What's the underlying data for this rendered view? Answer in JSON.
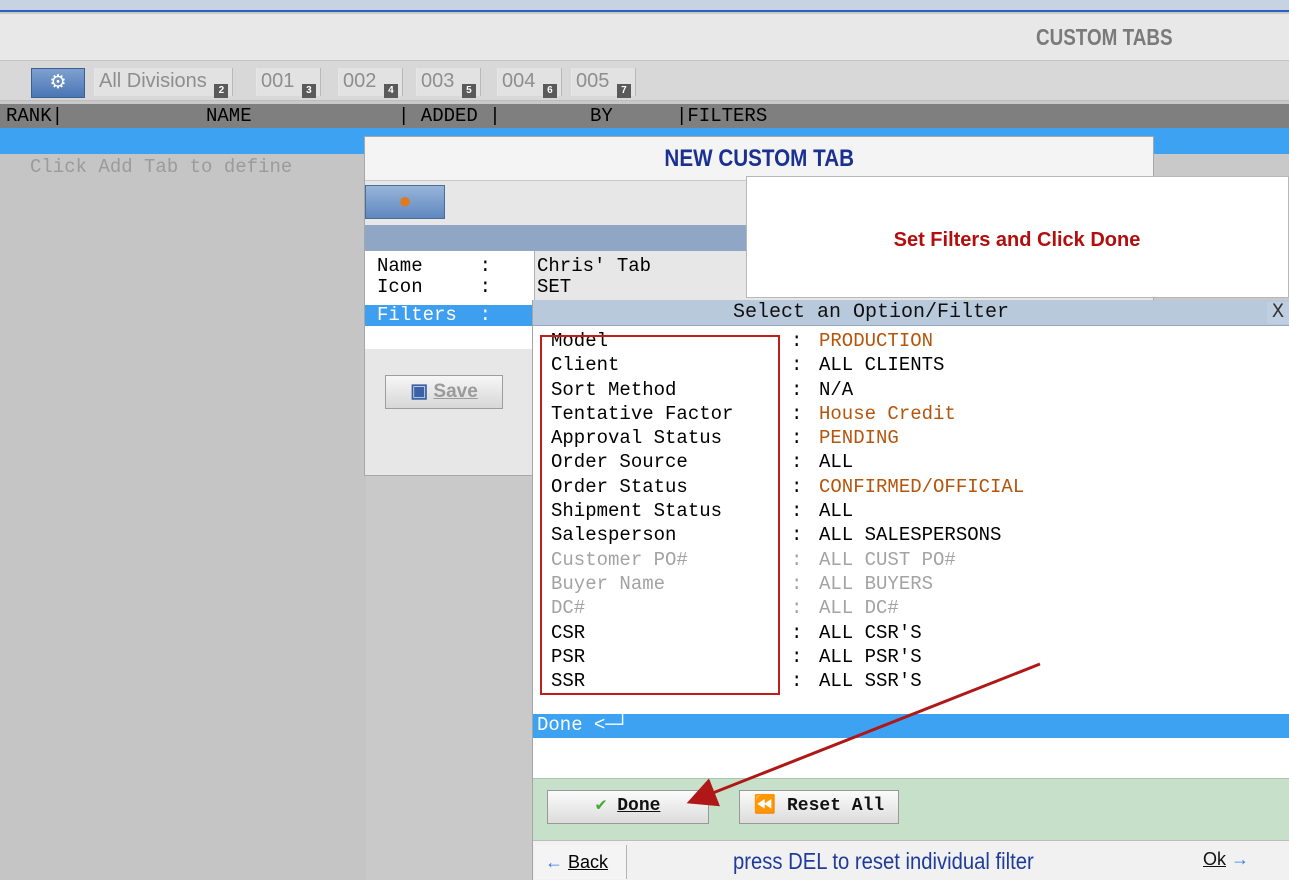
{
  "app": {
    "title": "CUSTOM TABS"
  },
  "tabs": {
    "gear_icon": "gear-icon",
    "items": [
      {
        "label": "All Divisions",
        "badge": "2"
      },
      {
        "label": "001",
        "badge": "3"
      },
      {
        "label": "002",
        "badge": "4"
      },
      {
        "label": "003",
        "badge": "5"
      },
      {
        "label": "004",
        "badge": "6"
      },
      {
        "label": "005",
        "badge": "7"
      }
    ]
  },
  "columns": {
    "rank": "RANK|",
    "name": "NAME",
    "added": "| ADDED |",
    "by": "BY",
    "filters": "|FILTERS"
  },
  "list": {
    "hint": "Click Add Tab to define"
  },
  "modal": {
    "title": "NEW CUSTOM TAB",
    "user_icon": "user-icon",
    "fields": {
      "name_label": "Name     :",
      "name_value": "Chris' Tab",
      "icon_label": "Icon     :",
      "icon_value": "SET",
      "filters_label": "Filters  :"
    },
    "save_label": "Save"
  },
  "callout": {
    "text": "Set Filters and Click Done"
  },
  "option_panel": {
    "title": "Select an Option/Filter",
    "close_label": "X",
    "separator": ":",
    "rows": [
      {
        "label": "Model",
        "value": "PRODUCTION",
        "state": "set"
      },
      {
        "label": "Client",
        "value": "ALL CLIENTS",
        "state": "normal"
      },
      {
        "label": "Sort Method",
        "value": "N/A",
        "state": "normal"
      },
      {
        "label": "Tentative Factor",
        "value": "House Credit",
        "state": "set"
      },
      {
        "label": "Approval Status",
        "value": "PENDING",
        "state": "set"
      },
      {
        "label": "Order Source",
        "value": "ALL",
        "state": "normal"
      },
      {
        "label": "Order Status",
        "value": "CONFIRMED/OFFICIAL",
        "state": "set"
      },
      {
        "label": "Shipment Status",
        "value": "ALL",
        "state": "normal"
      },
      {
        "label": "Salesperson",
        "value": "ALL SALESPERSONS",
        "state": "normal"
      },
      {
        "label": "Customer PO#",
        "value": "ALL CUST PO#",
        "state": "disabled"
      },
      {
        "label": "Buyer Name",
        "value": "ALL BUYERS",
        "state": "disabled"
      },
      {
        "label": "DC#",
        "value": "ALL DC#",
        "state": "disabled"
      },
      {
        "label": "CSR",
        "value": "ALL CSR'S",
        "state": "normal"
      },
      {
        "label": "PSR",
        "value": "ALL PSR'S",
        "state": "normal"
      },
      {
        "label": "SSR",
        "value": "ALL SSR'S",
        "state": "normal"
      }
    ],
    "done_row": "Done <─┘",
    "done_button": "Done",
    "reset_button": "Reset All",
    "back_label": "Back",
    "hint": "press DEL to reset individual filter",
    "ok_label": "Ok"
  },
  "colors": {
    "set_value": "#b5550c",
    "normal_text": "#000000",
    "disabled_text": "#a3a3a3",
    "accent_blue": "#3da2f2",
    "callout_red": "#b30d0d"
  }
}
